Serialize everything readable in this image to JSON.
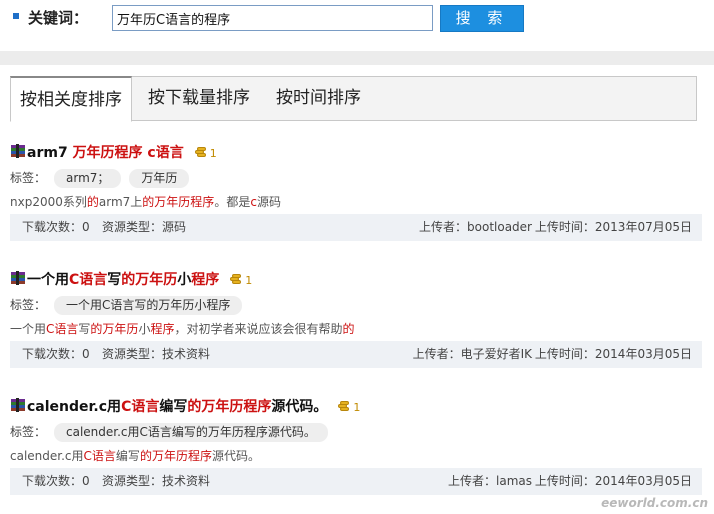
{
  "search": {
    "label": "关键词：",
    "value": "万年历C语言的程序",
    "button": "搜 索"
  },
  "tabs": [
    "按相关度排序",
    "按下载量排序",
    "按时间排序"
  ],
  "results": [
    {
      "title": [
        {
          "t": "arm7 ",
          "hl": false
        },
        {
          "t": "万年历程序 c语言",
          "hl": true
        }
      ],
      "coins": "1",
      "tags_label": "标签：",
      "tags": [
        "arm7；",
        "万年历"
      ],
      "desc": [
        {
          "t": "nxp2000系列",
          "hl": false
        },
        {
          "t": "的",
          "hl": true
        },
        {
          "t": "arm7上",
          "hl": false
        },
        {
          "t": "的万年历程序",
          "hl": true
        },
        {
          "t": "。都是",
          "hl": false
        },
        {
          "t": "c",
          "hl": true
        },
        {
          "t": "源码",
          "hl": false
        }
      ],
      "downloads": "下载次数：0",
      "type": "资源类型：源码",
      "uploader": "上传者：bootloader",
      "time": "上传时间：2013年07月05日"
    },
    {
      "title": [
        {
          "t": "一个用",
          "hl": false
        },
        {
          "t": "C语言",
          "hl": true
        },
        {
          "t": "写",
          "hl": false
        },
        {
          "t": "的万年历",
          "hl": true
        },
        {
          "t": "小",
          "hl": false
        },
        {
          "t": "程序",
          "hl": true
        }
      ],
      "coins": "1",
      "tags_label": "标签：",
      "tags": [
        "一个用C语言写的万年历小程序"
      ],
      "desc": [
        {
          "t": "一个用",
          "hl": false
        },
        {
          "t": "C语言",
          "hl": true
        },
        {
          "t": "写",
          "hl": false
        },
        {
          "t": "的万年历",
          "hl": true
        },
        {
          "t": "小",
          "hl": false
        },
        {
          "t": "程序",
          "hl": true
        },
        {
          "t": "，对初学者来说应该会很有帮助",
          "hl": false
        },
        {
          "t": "的",
          "hl": true
        }
      ],
      "downloads": "下载次数：0",
      "type": "资源类型：技术资料",
      "uploader": "上传者：电子爱好者IK",
      "time": "上传时间：2014年03月05日"
    },
    {
      "title": [
        {
          "t": "calender.c用",
          "hl": false
        },
        {
          "t": "C语言",
          "hl": true
        },
        {
          "t": "编写",
          "hl": false
        },
        {
          "t": "的万年历程序",
          "hl": true
        },
        {
          "t": "源代码。",
          "hl": false
        }
      ],
      "coins": "1",
      "tags_label": "标签：",
      "tags": [
        "calender.c用C语言编写的万年历程序源代码。"
      ],
      "desc": [
        {
          "t": "calender.c用",
          "hl": false
        },
        {
          "t": "C语言",
          "hl": true
        },
        {
          "t": "编写",
          "hl": false
        },
        {
          "t": "的万年历程序",
          "hl": true
        },
        {
          "t": "源代码。",
          "hl": false
        }
      ],
      "downloads": "下载次数：0",
      "type": "资源类型：技术资料",
      "uploader": "上传者：lamas",
      "time": "上传时间：2014年03月05日"
    }
  ],
  "watermark": "eeworld.com.cn",
  "colors": {
    "highlight": "#cc1111",
    "button": "#1d8fe0",
    "meta_bg": "#eef1f5"
  }
}
